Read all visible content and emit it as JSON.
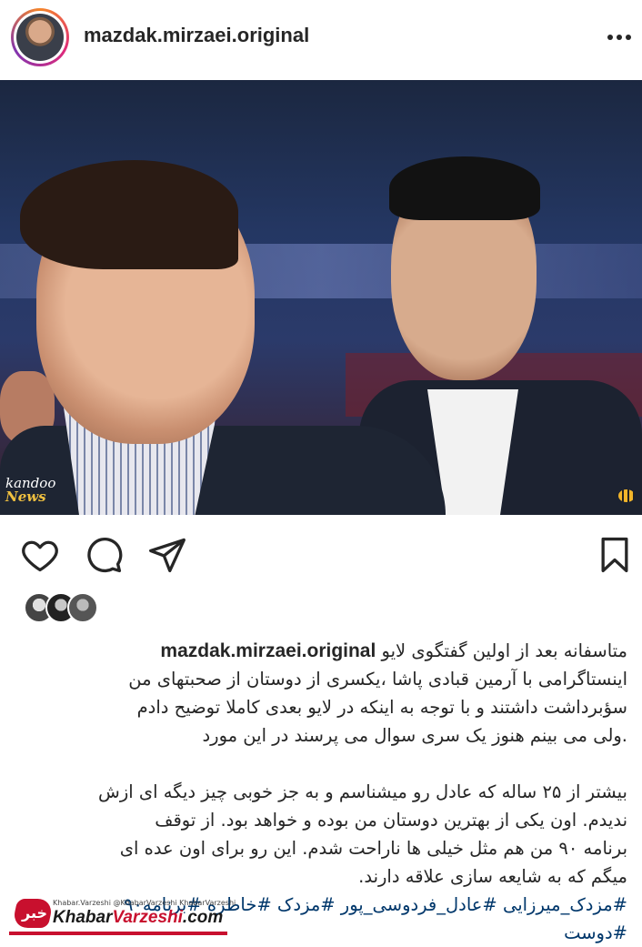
{
  "header": {
    "username": "mazdak.mirzaei.original",
    "avatar": "profile-photo",
    "more_icon": "ellipsis-horizontal-icon"
  },
  "post_image": {
    "watermark_left_script": "kandoo",
    "watermark_left_word": "News"
  },
  "actions": {
    "like_icon": "heart-icon",
    "comment_icon": "comment-bubble-icon",
    "share_icon": "paper-plane-icon",
    "save_icon": "bookmark-icon"
  },
  "likes": {
    "avatars": [
      "liker-avatar-1",
      "liker-avatar-2",
      "liker-avatar-3"
    ]
  },
  "caption": {
    "username": "mazdak.mirzaei.original",
    "paragraph1": [
      "متاسفانه بعد از اولین گفتگوی لایو",
      "اینستاگرامی با آرمین قبادی پاشا ،یکسری از دوستان از صحبتهای من",
      "سؤبرداشت داشتند و با توجه به اینکه در لایو بعدی کاملا توضیح دادم",
      ".ولی می بینم هنوز یک سری  سوال می پرسند در این مورد"
    ],
    "paragraph2": [
      "بیشتر از ۲۵ ساله که عادل رو میشناسم و به جز خوبی چیز دیگه ای ازش",
      "ندیدم. اون یکی از بهترین دوستان من بوده و خواهد بود. از توقف",
      "برنامه ۹۰ من هم مثل خیلی ها ناراحت شدم. این رو برای اون عده ای",
      "میگم که به شایعه سازی علاقه دارند."
    ],
    "hashtags_line1": "#مزدک_میرزایی #عادل_فردوسی_پور #مزدک #خاطره #برنامه۹۰",
    "hashtags_line2": "#دوست"
  },
  "footer_watermark": {
    "logo_text": "خبر",
    "handles": "Khabar.Varzeshi  @KhabarVarzeshi  KhabarVarzeshi",
    "site_prefix": "Khabar",
    "site_main": "Varzeshi",
    "site_suffix": ".com"
  },
  "colors": {
    "text": "#262626",
    "hashtag": "#00376b",
    "brand_red": "#c8102e"
  }
}
